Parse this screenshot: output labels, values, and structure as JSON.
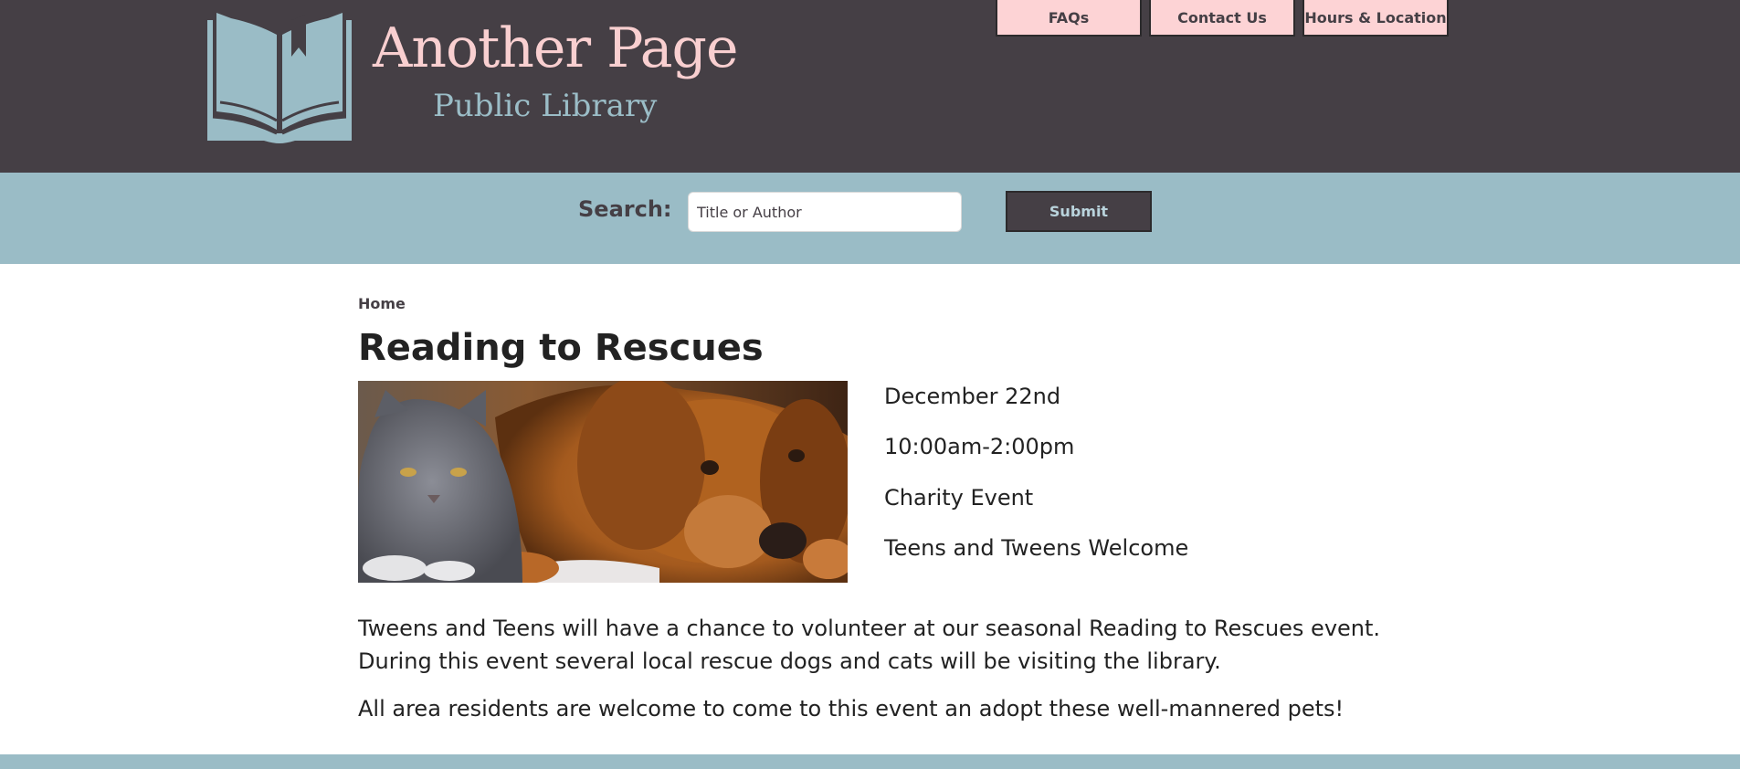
{
  "brand": {
    "name": "Another Page",
    "subtitle": "Public Library"
  },
  "nav": {
    "faqs": "FAQs",
    "contact": "Contact Us",
    "hours": "Hours & Location"
  },
  "search": {
    "label": "Search:",
    "placeholder": "Title or Author",
    "submit_label": "Submit"
  },
  "breadcrumb": {
    "home": "Home"
  },
  "event": {
    "title": "Reading to Rescues",
    "details": [
      "December 22nd",
      "10:00am-2:00pm",
      "Charity Event",
      "Teens and Tweens Welcome"
    ],
    "paragraphs": [
      "Tweens and Teens will have a chance to volunteer at our seasonal Reading to Rescues event.",
      "During this event several local rescue dogs and cats will be visiting the library.",
      "All area residents are welcome to come to this event an adopt these well-mannered pets!"
    ]
  },
  "colors": {
    "header_bg": "#453f45",
    "accent_blue": "#9abcc6",
    "accent_pink": "#fdd3d5"
  }
}
